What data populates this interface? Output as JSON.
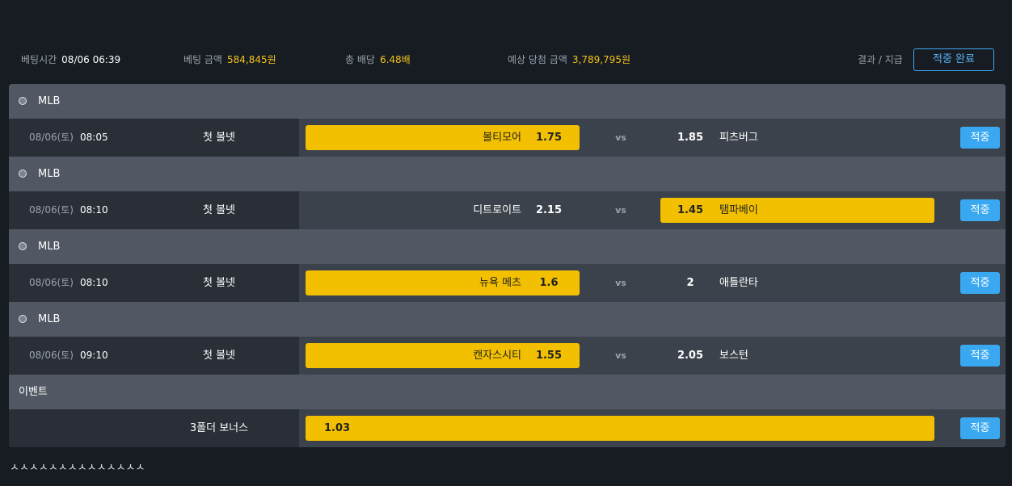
{
  "summary": {
    "bet_time_label": "베팅시간",
    "bet_time_value": "08/06 06:39",
    "bet_amount_label": "베팅 금액",
    "bet_amount_value": "584,845원",
    "total_odds_label": "총 배당",
    "total_odds_value": "6.48배",
    "expected_win_label": "예상 당첨 금액",
    "expected_win_value": "3,789,795원",
    "result_label": "결과 / 지급",
    "status_button": "적중 완료"
  },
  "vs_label": "vs",
  "hit_label": "적중",
  "matches": [
    {
      "league": "MLB",
      "date": "08/06(토)",
      "time": "08:05",
      "type": "첫 볼넷",
      "home": "볼티모어",
      "home_odds": "1.75",
      "away_odds": "1.85",
      "away": "피츠버그",
      "pick": "home"
    },
    {
      "league": "MLB",
      "date": "08/06(토)",
      "time": "08:10",
      "type": "첫 볼넷",
      "home": "디트로이트",
      "home_odds": "2.15",
      "away_odds": "1.45",
      "away": "탬파베이",
      "pick": "away"
    },
    {
      "league": "MLB",
      "date": "08/06(토)",
      "time": "08:10",
      "type": "첫 볼넷",
      "home": "뉴욕 메츠",
      "home_odds": "1.6",
      "away_odds": "2",
      "away": "애틀란타",
      "pick": "home"
    },
    {
      "league": "MLB",
      "date": "08/06(토)",
      "time": "09:10",
      "type": "첫 볼넷",
      "home": "캔자스시티",
      "home_odds": "1.55",
      "away_odds": "2.05",
      "away": "보스턴",
      "pick": "home"
    }
  ],
  "event": {
    "header": "이벤트",
    "name": "3폴더 보너스",
    "odds": "1.03"
  },
  "footer_marks": "ㅅㅅㅅㅅㅅㅅㅅㅅㅅㅅㅅㅅㅅㅅ",
  "colors": {
    "background": "#171c23",
    "panel": "#515863",
    "row": "#3c424b",
    "selected": "#f2c000",
    "accent": "#3aa8f0",
    "gold_text": "#f2c21b"
  }
}
